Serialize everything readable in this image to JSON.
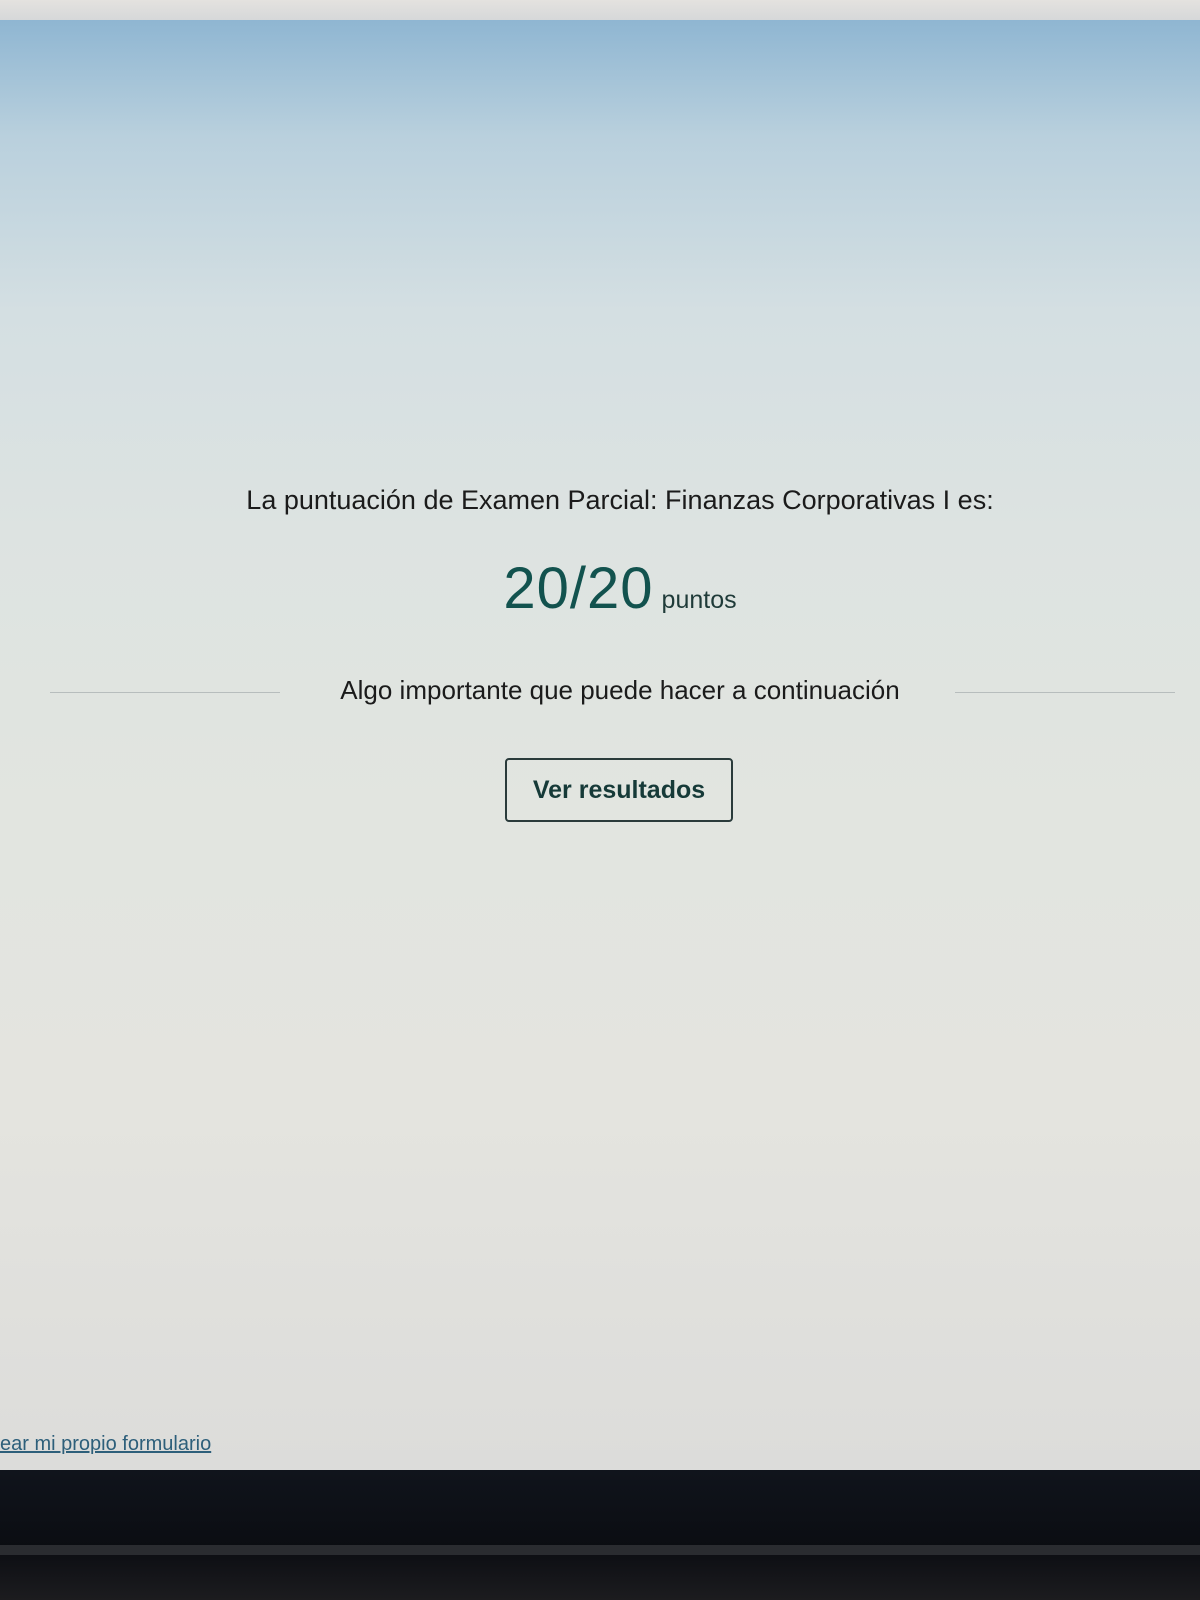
{
  "result": {
    "score_label": "La puntuación de Examen Parcial: Finanzas Corporativas I es:",
    "score_value": "20/20",
    "score_unit": "puntos"
  },
  "next_steps": {
    "heading": "Algo importante que puede hacer a continuación",
    "results_button_label": "Ver resultados"
  },
  "footer": {
    "create_form_link": "ear mi propio formulario"
  },
  "colors": {
    "accent": "#12524e",
    "link": "#2d5f7a"
  }
}
